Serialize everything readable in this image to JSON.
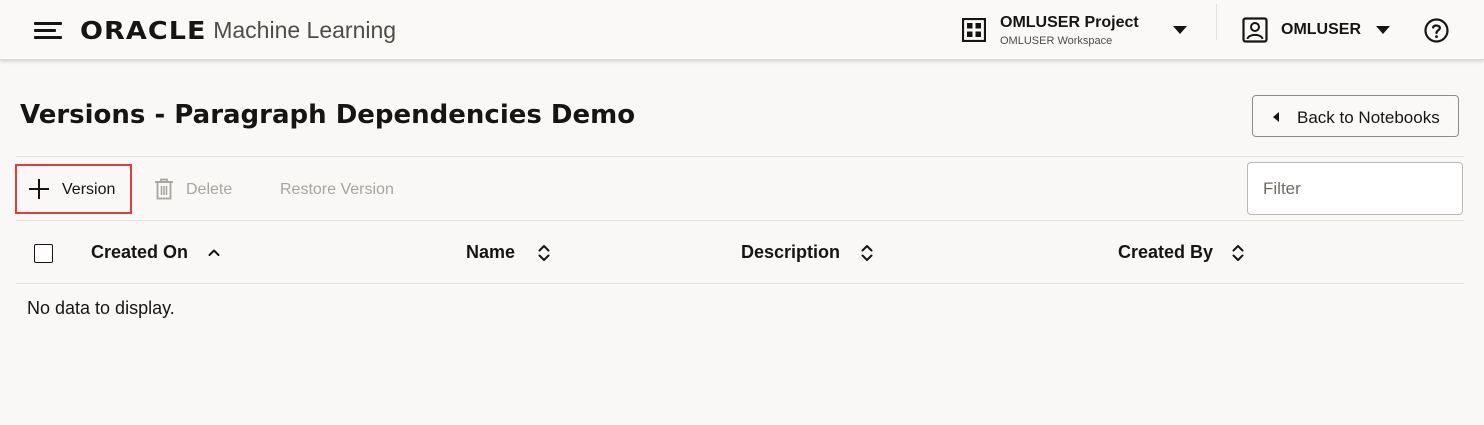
{
  "header": {
    "brand": "ORACLE",
    "app_name": "Machine Learning",
    "project": {
      "name": "OMLUSER Project",
      "workspace": "OMLUSER Workspace"
    },
    "user": {
      "name": "OMLUSER"
    }
  },
  "page": {
    "title": "Versions - Paragraph Dependencies Demo",
    "back_button": "Back to Notebooks"
  },
  "toolbar": {
    "add_version": "Version",
    "delete": "Delete",
    "restore": "Restore Version",
    "filter_placeholder": "Filter"
  },
  "table": {
    "columns": [
      {
        "label": "Created On",
        "sort": "ascending"
      },
      {
        "label": "Name",
        "sort": "unsorted"
      },
      {
        "label": "Description",
        "sort": "unsorted"
      },
      {
        "label": "Created By",
        "sort": "unsorted"
      }
    ],
    "rows": [],
    "empty_message": "No data to display."
  },
  "colors": {
    "highlight": "#e53c3c",
    "disabled_text": "#a8a49f",
    "background": "#f9f8f6"
  }
}
